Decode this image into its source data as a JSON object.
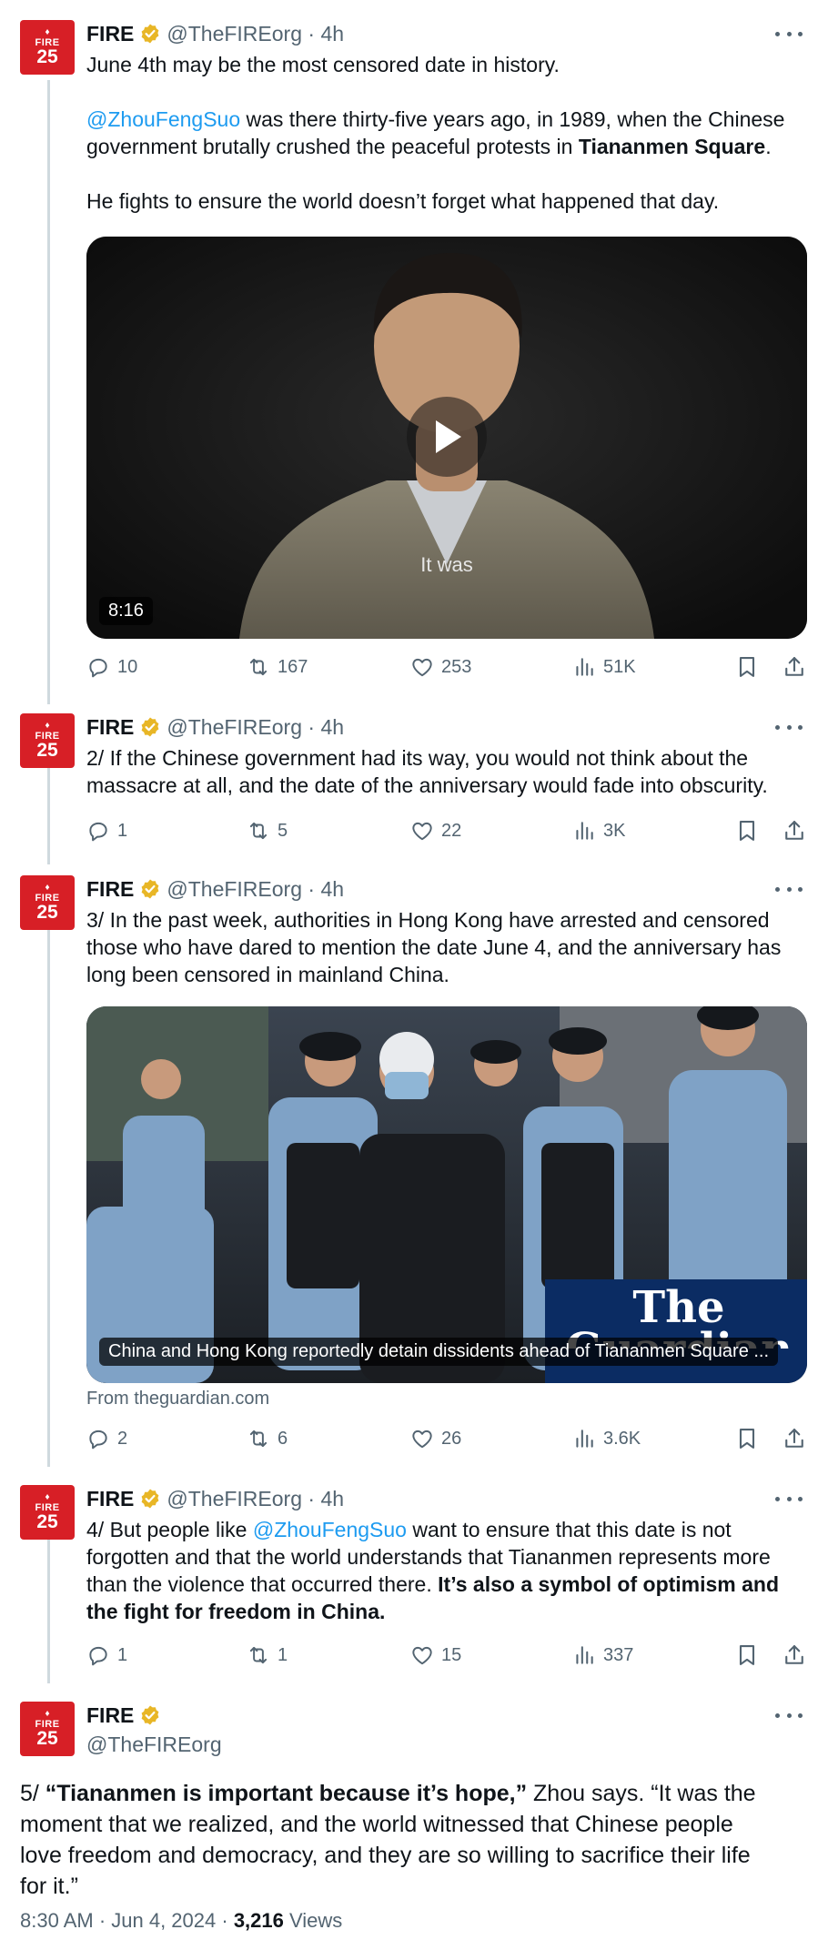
{
  "brand": {
    "accent": "#1d9bf0",
    "avatar_red": "#d71f26",
    "avatar_top": "FIRE",
    "avatar_num": "25"
  },
  "tweets": [
    {
      "name": "FIRE",
      "handle": "@TheFIREorg",
      "time": "4h",
      "lines": [
        {
          "t": "June 4th may be the most censored date in history."
        },
        {
          "t": ""
        },
        {
          "m": "@ZhouFengSuo",
          "t": " was there thirty-five years ago, in 1989, when the Chinese"
        },
        {
          "t": "government brutally crushed the peaceful protests in ",
          "b": "Tiananmen Square",
          "e": "."
        },
        {
          "t": ""
        },
        {
          "t": "He fights to ensure the world doesn’t forget what happened that day."
        }
      ],
      "video": {
        "duration": "8:16",
        "caption": "It was"
      },
      "stats": {
        "replies": "10",
        "reposts": "167",
        "likes": "253",
        "views": "51K"
      }
    },
    {
      "name": "FIRE",
      "handle": "@TheFIREorg",
      "time": "4h",
      "lines": [
        {
          "t": "2/ If the Chinese government had its way, you would not think about the"
        },
        {
          "t": "massacre at all, and the date of the anniversary would fade into obscurity."
        }
      ],
      "stats": {
        "replies": "1",
        "reposts": "5",
        "likes": "22",
        "views": "3K"
      }
    },
    {
      "name": "FIRE",
      "handle": "@TheFIREorg",
      "time": "4h",
      "lines": [
        {
          "t": "3/ In the past week, authorities in Hong Kong have arrested and censored"
        },
        {
          "t": "those who have dared to mention the date June 4, and the anniversary has"
        },
        {
          "t": "long been censored in mainland China."
        }
      ],
      "card": {
        "title": "China and Hong Kong reportedly detain dissidents ahead of Tiananmen Square ...",
        "watermark_1": "The",
        "watermark_2": "Guardian",
        "source": "From theguardian.com"
      },
      "stats": {
        "replies": "2",
        "reposts": "6",
        "likes": "26",
        "views": "3.6K"
      }
    },
    {
      "name": "FIRE",
      "handle": "@TheFIREorg",
      "time": "4h",
      "lines": [
        {
          "t": "4/ But people like ",
          "m": "@ZhouFengSuo",
          "e": " want to ensure that this date is not"
        },
        {
          "t": "forgotten and that the world understands that Tiananmen represents more"
        },
        {
          "t": "than the violence that occurred there. ",
          "b": "It’s also a symbol of optimism and"
        },
        {
          "b": "the fight for freedom in China."
        }
      ],
      "stats": {
        "replies": "1",
        "reposts": "1",
        "likes": "15",
        "views": "337"
      }
    }
  ],
  "main": {
    "name": "FIRE",
    "handle": "@TheFIREorg",
    "lines": [
      {
        "t": "5/ ",
        "b": "“Tiananmen is important because it’s hope,”",
        "e": " Zhou says. “It was the"
      },
      {
        "t": "moment that we realized, and the world witnessed that Chinese people"
      },
      {
        "t": "love freedom and democracy, and they are so willing to sacrifice their life"
      },
      {
        "t": "for it.”"
      }
    ],
    "timestamp": "8:30 AM · Jun 4, 2024 · ",
    "views": "3,216",
    "views_label": " Views"
  },
  "icons": [
    "reply-icon",
    "repost-icon",
    "like-icon",
    "views-icon",
    "bookmark-icon",
    "share-icon",
    "verified-badge-icon",
    "more-icon",
    "play-icon",
    "flame-icon"
  ]
}
